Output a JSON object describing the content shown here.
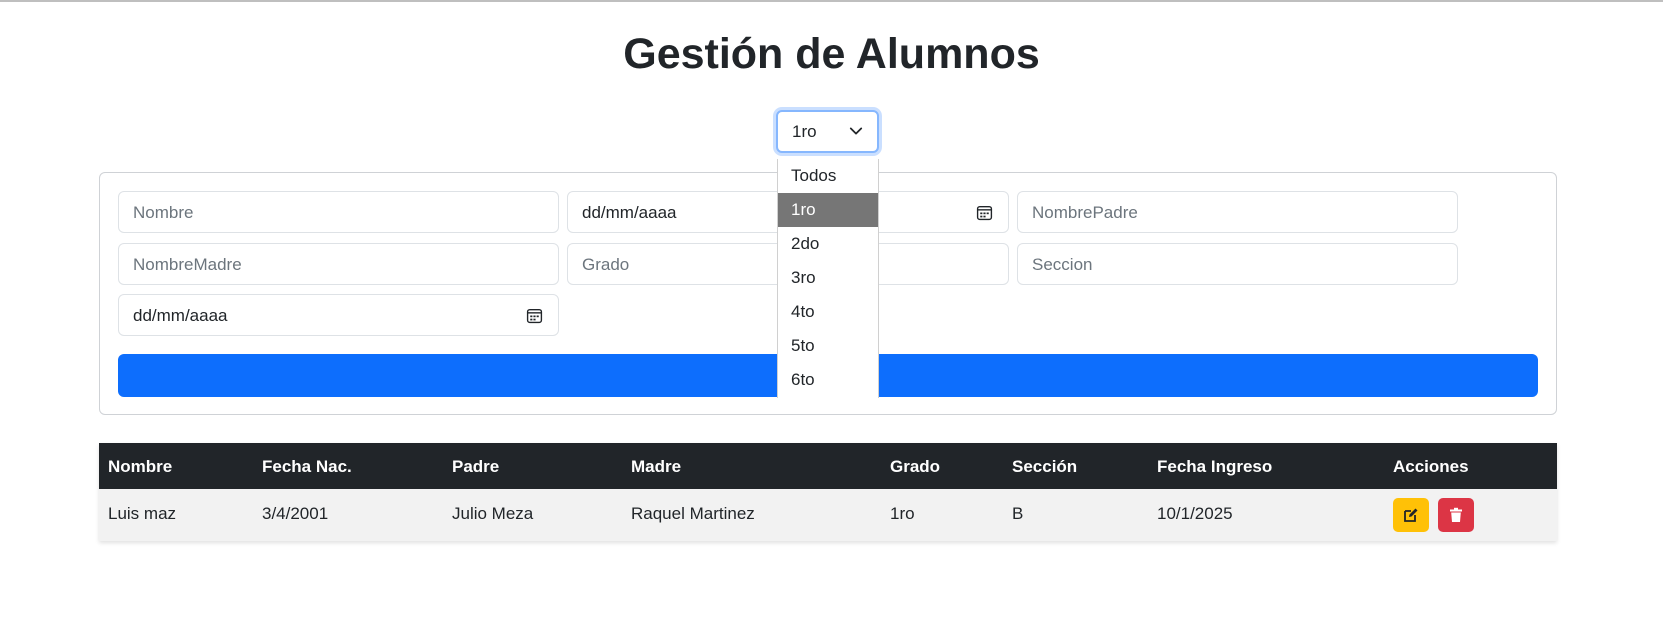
{
  "page": {
    "title": "Gestión de Alumnos"
  },
  "grade_filter": {
    "selected": "1ro",
    "options": [
      "Todos",
      "1ro",
      "2do",
      "3ro",
      "4to",
      "5to",
      "6to"
    ]
  },
  "form": {
    "nombre_placeholder": "Nombre",
    "fecha_nac_value": "dd/mm/aaaa",
    "nombre_padre_placeholder": "NombrePadre",
    "nombre_madre_placeholder": "NombreMadre",
    "grado_placeholder": "Grado",
    "seccion_placeholder": "Seccion",
    "fecha_ingreso_value": "dd/mm/aaaa",
    "submit_label": ""
  },
  "table": {
    "headers": [
      "Nombre",
      "Fecha Nac.",
      "Padre",
      "Madre",
      "Grado",
      "Sección",
      "Fecha Ingreso",
      "Acciones"
    ],
    "rows": [
      [
        "Luis maz",
        "3/4/2001",
        "Julio Meza",
        "Raquel Martinez",
        "1ro",
        "B",
        "10/1/2025"
      ]
    ]
  },
  "icons": {
    "filter_chevron": "chevron-down-icon",
    "date_picker": "calendar-icon",
    "edit_action": "edit-icon",
    "delete_action": "trash-icon"
  },
  "colors": {
    "primary": "#0d6efd",
    "header_dark": "#212529",
    "edit_warning": "#ffc107",
    "delete_danger": "#dc3545",
    "dropdown_selected": "#767676"
  }
}
